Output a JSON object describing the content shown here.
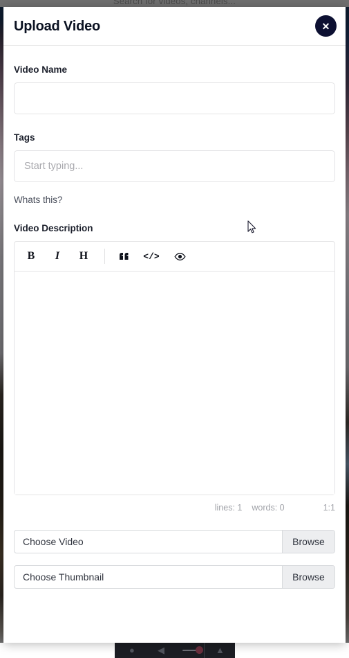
{
  "background": {
    "search_placeholder": "Search for videos, channels...",
    "page_bg_color": "#6f6f6f"
  },
  "bottom_toolbar": {
    "icon_1": "person-icon",
    "icon_2": "volume-icon",
    "icon_3": "cast-icon",
    "slider_name": "volume-slider"
  },
  "modal": {
    "title": "Upload Video",
    "close_label": "✕",
    "accent_color": "#0d1032",
    "fields": {
      "video_name": {
        "label": "Video Name",
        "value": "",
        "placeholder": ""
      },
      "tags": {
        "label": "Tags",
        "value": "",
        "placeholder": "Start typing..."
      },
      "whats_this": "Whats this?",
      "video_description": {
        "label": "Video Description",
        "value": "",
        "placeholder": ""
      }
    },
    "editor": {
      "toolbar": [
        {
          "name": "bold-icon",
          "glyph": "B"
        },
        {
          "name": "italic-icon",
          "glyph": "I"
        },
        {
          "name": "heading-icon",
          "glyph": "H"
        },
        {
          "name": "quote-icon",
          "glyph": "“"
        },
        {
          "name": "code-icon",
          "glyph": "</>"
        },
        {
          "name": "preview-eye-icon",
          "glyph": "◉"
        }
      ],
      "status": {
        "lines": "lines: 1",
        "words": "words: 0",
        "position": "1:1"
      }
    },
    "file_pickers": [
      {
        "label": "Choose Video",
        "button": "Browse"
      },
      {
        "label": "Choose Thumbnail",
        "button": "Browse"
      }
    ]
  }
}
